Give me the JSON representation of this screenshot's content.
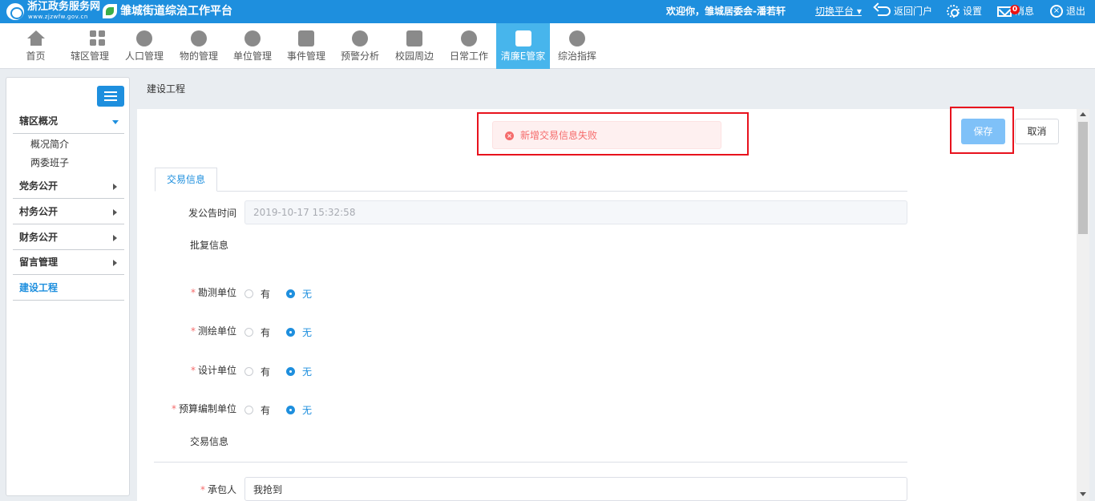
{
  "topbar": {
    "site_name": "浙江政务服务网",
    "site_domain": "www.zjzwfw.gov.cn",
    "platform_name": "雏城街道综治工作平台",
    "welcome": "欢迎你，雏城居委会-潘若轩",
    "switch_platform": "切换平台 ▾",
    "back_portal": "返回门户",
    "settings": "设置",
    "messages": "消息",
    "message_count": "0",
    "logout": "退出"
  },
  "nav": [
    {
      "label": "首页",
      "icon": "home-icon"
    },
    {
      "label": "辖区管理",
      "icon": "grid-icon"
    },
    {
      "label": "人口管理",
      "icon": "people-icon"
    },
    {
      "label": "物的管理",
      "icon": "vehicle-icon"
    },
    {
      "label": "单位管理",
      "icon": "unit-icon"
    },
    {
      "label": "事件管理",
      "icon": "event-icon"
    },
    {
      "label": "预警分析",
      "icon": "warning-icon"
    },
    {
      "label": "校园周边",
      "icon": "campus-icon"
    },
    {
      "label": "日常工作",
      "icon": "worker-icon"
    },
    {
      "label": "清廉E管家",
      "icon": "steward-icon",
      "active": true
    },
    {
      "label": "综治指挥",
      "icon": "command-icon"
    }
  ],
  "sidebar": {
    "groups": [
      {
        "label": "辖区概况",
        "expanded": true,
        "children": [
          "概况简介",
          "两委班子"
        ]
      },
      {
        "label": "党务公开"
      },
      {
        "label": "村务公开"
      },
      {
        "label": "财务公开"
      },
      {
        "label": "留言管理"
      },
      {
        "label": "建设工程",
        "active": true
      }
    ]
  },
  "main": {
    "breadcrumb": "建设工程",
    "alert_message": "新增交易信息失败",
    "save_label": "保存",
    "cancel_label": "取消",
    "tab_label": "交易信息",
    "announce_time_label": "发公告时间",
    "announce_time_value": "2019-10-17 15:32:58",
    "approval_section": "批复信息",
    "radio_rows": [
      {
        "label": "勘测单位",
        "yes": "有",
        "no": "无",
        "selected": "无"
      },
      {
        "label": "测绘单位",
        "yes": "有",
        "no": "无",
        "selected": "无"
      },
      {
        "label": "设计单位",
        "yes": "有",
        "no": "无",
        "selected": "无"
      },
      {
        "label": "预算编制单位",
        "yes": "有",
        "no": "无",
        "selected": "无"
      }
    ],
    "trade_section": "交易信息",
    "contractor_label": "承包人",
    "contractor_value": "我抢到"
  },
  "colors": {
    "brand": "#1e8fde",
    "active_nav": "#47b5ec",
    "error": "#f56c6c",
    "highlight_box": "#e8121d"
  }
}
